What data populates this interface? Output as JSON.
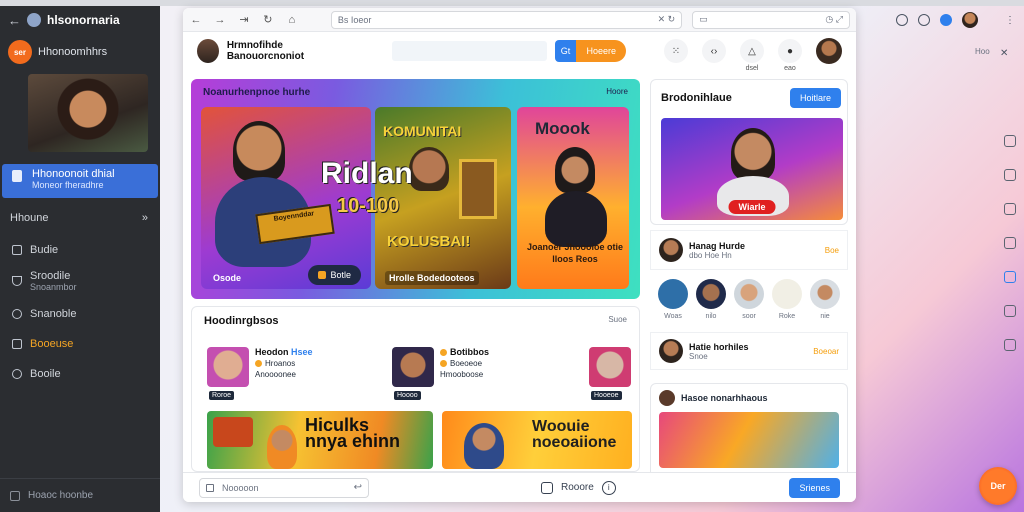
{
  "sidebar": {
    "app_name": "hlsonornaria",
    "user_badge": "ser",
    "user_name": "Hhonoomhhrs",
    "active_item": {
      "title": "Hhonoonoit dhial",
      "subtitle": "Moneor fheradhre"
    },
    "section_label": "Hhoune",
    "items": [
      {
        "label": "Budie"
      },
      {
        "label": "Sroodile",
        "sub": "Snoanmbor"
      },
      {
        "label": "Snanoble"
      },
      {
        "label": "Booeuse"
      },
      {
        "label": "Booile"
      }
    ],
    "footer_label": "Hoaoc hoonbe"
  },
  "browser": {
    "url_text": "Bs Ioeor",
    "header_title": "Hrmnofihde Banouorcnoniot",
    "search_btn_icon": "Gt",
    "orange_btn": "Hoeere",
    "header_icon_labels": [
      "dsel",
      "eao"
    ]
  },
  "hero": {
    "title": "Noanurhenpnoe hurhe",
    "more": "Hoore",
    "card1": {
      "caption": "Osode",
      "pill": "Botle",
      "sign": "Boyennddar",
      "big_line1": "Ridlan",
      "big_line2": "10-100"
    },
    "card2": {
      "label": "KOMUNITAI",
      "sub_label": "KOLUSBAI!",
      "caption": "Hrolle Bodedooteos"
    },
    "card3": {
      "label": "Moook",
      "caption": "Joanoer Jhoooioe otie lloos Reos"
    }
  },
  "right_panel": {
    "title": "Brodonihlaue",
    "button": "Hoitlare",
    "badge": "Wiarle",
    "row1": {
      "name": "Hanag Hurde",
      "meta": "dbo Hoe Hn",
      "tag": "Boe"
    },
    "avatar_labels": [
      "Woas",
      "nilo",
      "soor",
      "Roke",
      "nie"
    ],
    "row2": {
      "name": "Hatie horhiles",
      "tag": "Boeoar",
      "meta": "Snoe"
    },
    "bottom_title": "Hasoe nonarhhaous"
  },
  "lower": {
    "title": "Hoodinrgbsos",
    "more": "Suoe",
    "post1": {
      "name": "Heodon",
      "highlight": "Hsee",
      "line2": "Hroanos",
      "line3": "Anoooonee",
      "cap": "Roroe"
    },
    "post2": {
      "name": "Botibbos",
      "line2": "Boeoeoe",
      "line3": "Hmooboose",
      "cap": "Hoooo"
    },
    "post3": {
      "cap": "Hooeoe"
    },
    "promo1": {
      "line1": "Hiculks",
      "line2": "nnya ehinn"
    },
    "promo2": {
      "line1": "Woouie",
      "line2": "noeoaiione"
    }
  },
  "footer": {
    "compose_text": "Nooooon",
    "center_text": "Rooore",
    "button": "Srienes"
  },
  "window": {
    "right_label": "Hoo",
    "fab_text": "Der"
  }
}
